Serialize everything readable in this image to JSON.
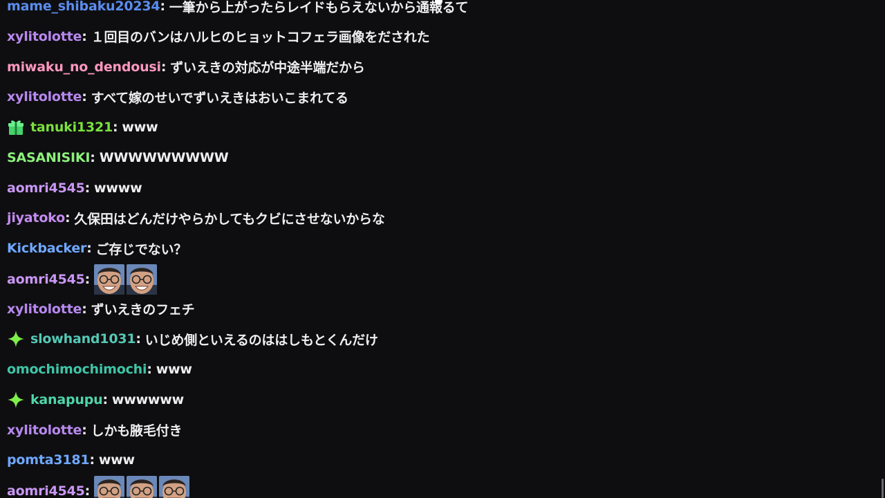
{
  "chat": {
    "messages": [
      {
        "user": "mame_shibaku20234",
        "text": "一筆から上がったらレイドもらえないから通報るて",
        "color": "#5b8def"
      },
      {
        "user": "xylitolotte",
        "text": "１回目のバンはハルヒのヒョットコフェラ画像をだされた",
        "color": "#b888f0"
      },
      {
        "user": "miwaku_no_dendousi",
        "text": "ずいえきの対応が中途半端だから",
        "color": "#ff98bf"
      },
      {
        "user": "xylitolotte",
        "text": "すべて嫁のせいでずいえきはおいこまれてる",
        "color": "#b888f0"
      },
      {
        "user": "tanuki1321",
        "text": "www",
        "color": "#7be13e",
        "badge": "gift-icon"
      },
      {
        "user": "SASANISIKI",
        "text": "WWWWWWWWW",
        "color": "#8df07c"
      },
      {
        "user": "aomri4545",
        "text": "wwww",
        "color": "#c997f5"
      },
      {
        "user": "jiyatoko",
        "text": "久保田はどんだけやらかしてもクビにさせないからな",
        "color": "#c58cf2"
      },
      {
        "user": "Kickbacker",
        "text": "ご存じでない？",
        "color": "#6fa8ff"
      },
      {
        "user": "aomri4545",
        "text": "",
        "color": "#c997f5",
        "emotes": 2
      },
      {
        "user": "xylitolotte",
        "text": "ずいえきのフェチ",
        "color": "#b888f0"
      },
      {
        "user": "slowhand1031",
        "text": "いじめ側といえるのははしもとくんだけ",
        "color": "#55c9b6",
        "badge": "sparkle-icon"
      },
      {
        "user": "omochimochimochi",
        "text": "www",
        "color": "#3fc5a6"
      },
      {
        "user": "kanapupu",
        "text": "wwwwww",
        "color": "#4fd6a8",
        "badge": "sparkle-icon"
      },
      {
        "user": "xylitolotte",
        "text": "しかも腋毛付き",
        "color": "#b888f0"
      },
      {
        "user": "pomta3181",
        "text": "www",
        "color": "#6fa8ff"
      },
      {
        "user": "aomri4545",
        "text": "",
        "color": "#c997f5",
        "emotes": 3
      }
    ],
    "colon": ":"
  }
}
